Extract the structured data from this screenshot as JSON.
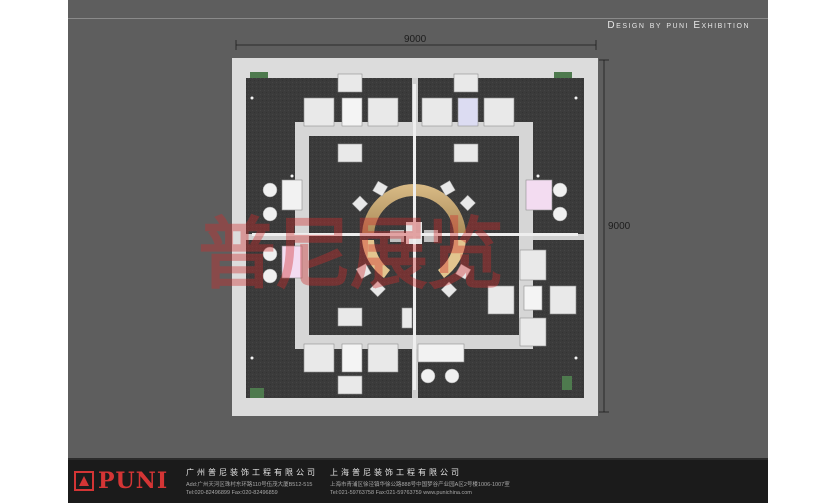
{
  "header": {
    "credit": "Design by puni Exhibition"
  },
  "dimensions": {
    "width_label": "9000",
    "height_label": "9000"
  },
  "watermark": {
    "text": "普尼展览"
  },
  "footer": {
    "brand": "PUNI",
    "company_left": {
      "name": "广州普尼装饰工程有限公司",
      "address": "Add:广州天河区珠村东环路110号伍茂大厦B512-515",
      "phones": "Tel:020-82496899    Fax:020-82496859"
    },
    "company_right": {
      "name": "上海普尼装饰工程有限公司",
      "address": "上海市青浦区徐泾镇华徐公路888号中国梦谷产业园A区2号楼1006-1007室",
      "phones": "Tel:021-59763758    Fax:021-59763759    www.punichina.com"
    }
  },
  "colors": {
    "background": "#5e5e5e",
    "floor": "#3a3a3a",
    "walls": "#dcdcdc",
    "accent": "#d43535",
    "stage": "#c7a877"
  },
  "icons": {
    "logo": "puni-logo-icon"
  }
}
